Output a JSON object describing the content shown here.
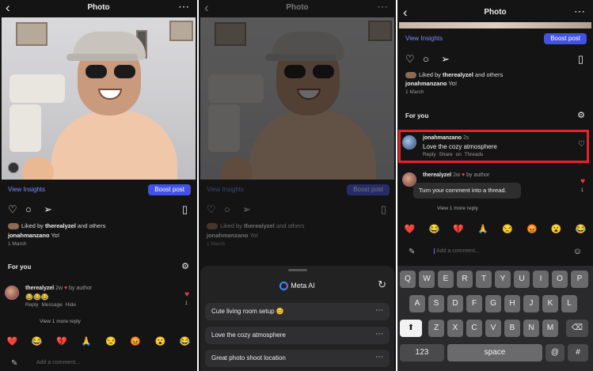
{
  "header": {
    "title": "Photo",
    "back_glyph": "‹",
    "more_glyph": "⋯"
  },
  "post": {
    "view_insights": "View Insights",
    "boost_label": "Boost post",
    "liked_prefix": "Liked by",
    "liked_user": "therealyzel",
    "liked_suffix": "and others",
    "caption_user": "jonahmanzano",
    "caption_text": "Yo!",
    "date": "1 March",
    "for_you": "For you"
  },
  "icons": {
    "like": "heart-icon",
    "comment": "comment-icon",
    "share": "send-icon",
    "save": "bookmark-icon",
    "filter": "filter-icon",
    "more": "more-icon"
  },
  "comment_main": {
    "user": "therealyzel",
    "time": "2w",
    "by_author": "by author",
    "text": "😂😂😂",
    "reply": "Reply",
    "message": "Message",
    "hide": "Hide",
    "like_count": "1",
    "view_more": "View 1 more reply"
  },
  "comment_new": {
    "user": "jonahmanzano",
    "time": "2s",
    "text": "Love the cozy atmosphere",
    "reply": "Reply",
    "share_threads": "Share on Threads"
  },
  "emoji_row": [
    "❤️",
    "😂",
    "💔",
    "🙏",
    "😒",
    "😡",
    "😮",
    "😂"
  ],
  "add_comment_placeholder": "Add a comment...",
  "meta_ai": {
    "title": "Meta AI",
    "suggestions": [
      "Cute living room setup 😊",
      "Love the cozy atmosphere",
      "Great photo shoot location"
    ]
  },
  "tooltip": "Turn your comment into a thread.",
  "keyboard": {
    "row1": [
      "Q",
      "W",
      "E",
      "R",
      "T",
      "Y",
      "U",
      "I",
      "O",
      "P"
    ],
    "row2": [
      "A",
      "S",
      "D",
      "F",
      "G",
      "H",
      "J",
      "K",
      "L"
    ],
    "row3": [
      "Z",
      "X",
      "C",
      "V",
      "B",
      "N",
      "M"
    ],
    "numbers": "123",
    "space": "space",
    "at": "@",
    "hash": "#"
  },
  "colors": {
    "accent": "#4451e8",
    "link": "#7b8dff",
    "highlight": "#e8202c",
    "heart": "#ff2f55"
  }
}
